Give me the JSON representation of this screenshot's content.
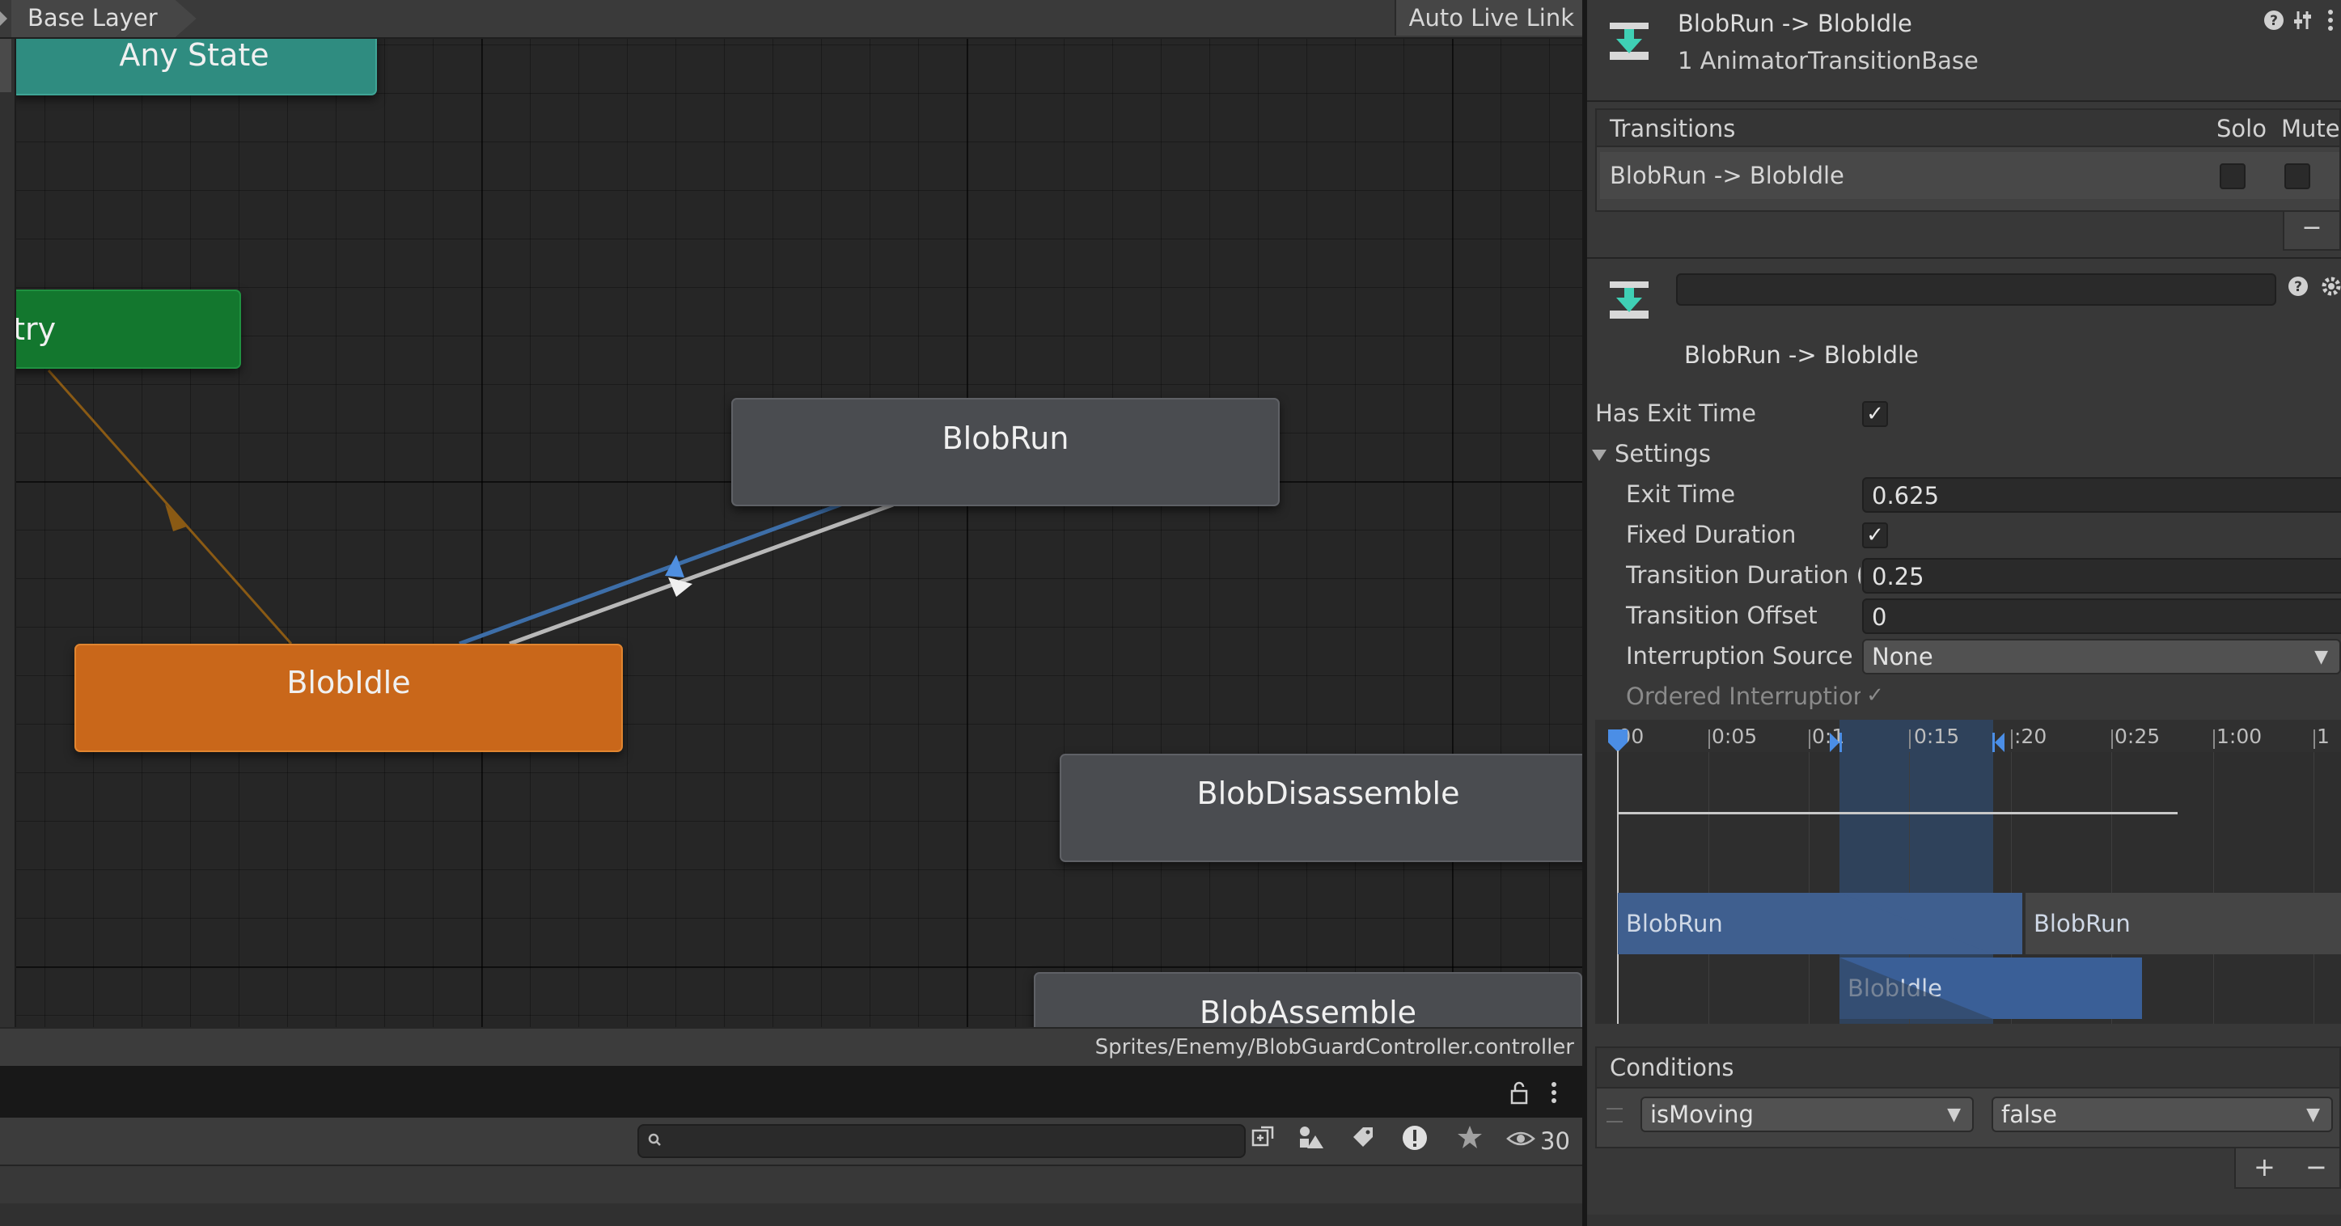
{
  "graph": {
    "breadcrumb": "Base Layer",
    "auto_live_link": "Auto Live Link",
    "footer_path": "Sprites/Enemy/BlobGuardController.controller",
    "nodes": {
      "any_state": "Any State",
      "entry": "ntry",
      "blob_run": "BlobRun",
      "blob_idle": "BlobIdle",
      "blob_disassemble": "BlobDisassemble",
      "blob_assemble": "BlobAssemble"
    },
    "colors": {
      "any_state": "#2f8c80",
      "entry": "#13772e",
      "default_state": "#c9671a",
      "state": "#4a4c50",
      "entry_transition": "#8a5a14",
      "selected_transition": "#3d6ea8",
      "transition": "#b8b8b8"
    }
  },
  "project": {
    "search_placeholder": "",
    "hidden_count": "30",
    "icons": [
      "lock-icon",
      "more-icon",
      "search-icon",
      "create-icon",
      "type-filter-icon",
      "label-filter-icon",
      "warning-filter-icon",
      "favorite-icon",
      "eye-icon"
    ]
  },
  "inspector": {
    "header": {
      "title": "BlobRun -> BlobIdle",
      "subtitle": "1 AnimatorTransitionBase"
    },
    "transitions": {
      "header": "Transitions",
      "solo": "Solo",
      "mute": "Mute",
      "rows": [
        {
          "name": "BlobRun -> BlobIdle",
          "solo": false,
          "mute": false
        }
      ],
      "remove_label": "−"
    },
    "transition": {
      "name_value": "",
      "display_name": "BlobRun -> BlobIdle",
      "has_exit_time_label": "Has Exit Time",
      "has_exit_time": true,
      "settings_label": "Settings",
      "exit_time_label": "Exit Time",
      "exit_time": "0.625",
      "fixed_duration_label": "Fixed Duration",
      "fixed_duration": true,
      "transition_duration_label": "Transition Duration (",
      "transition_duration": "0.25",
      "transition_offset_label": "Transition Offset",
      "transition_offset": "0",
      "interruption_source_label": "Interruption Source",
      "interruption_source": "None",
      "ordered_interruption_label": "Ordered Interruption",
      "ordered_interruption": true
    },
    "timeline": {
      "ticks": [
        ":00",
        "0:05",
        "0:1",
        "0:15",
        ":20",
        "0:25",
        "1:00",
        "1"
      ],
      "source_bar": "BlobRun",
      "source_bar_2": "BlobRun",
      "dest_bar": "BlobIdle",
      "colors": {
        "bar": "#3f5f8f",
        "highlight": "#2f4563",
        "dest": "#3a5f97"
      }
    },
    "conditions": {
      "header": "Conditions",
      "rows": [
        {
          "parameter": "isMoving",
          "value": "false"
        }
      ],
      "add_label": "+",
      "remove_label": "−"
    }
  }
}
